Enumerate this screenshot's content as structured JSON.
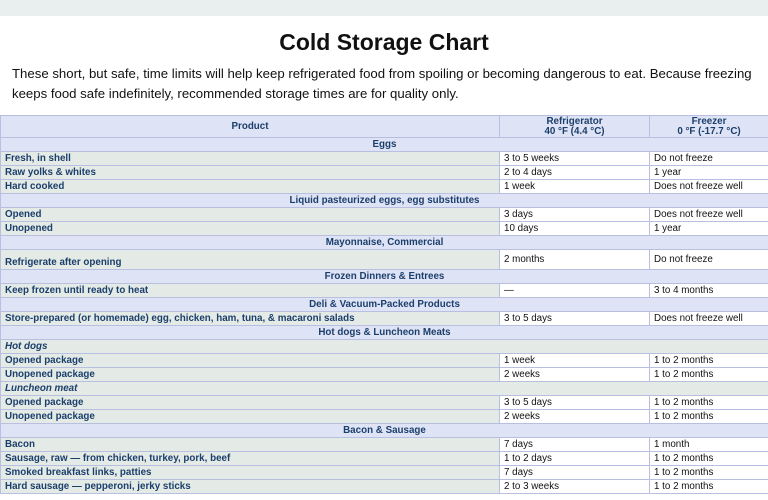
{
  "page": {
    "title": "Cold Storage Chart",
    "intro": "These short, but safe, time limits will help keep refrigerated food from spoiling or becoming dangerous to eat. Because freezing keeps food safe indefinitely, recommended storage times are for quality only."
  },
  "table": {
    "headers": {
      "product": "Product",
      "refrigerator": "Refrigerator",
      "refrigerator_temp": "40 °F (4.4 °C)",
      "freezer": "Freezer",
      "freezer_temp": "0 °F (-17.7 °C)"
    },
    "rows": [
      {
        "type": "cat",
        "label": "Eggs"
      },
      {
        "type": "item",
        "product": "Fresh, in shell",
        "refrigerator": "3 to 5 weeks",
        "freezer": "Do not freeze"
      },
      {
        "type": "item",
        "product": "Raw yolks & whites",
        "refrigerator": "2 to 4 days",
        "freezer": "1 year"
      },
      {
        "type": "item",
        "product": "Hard cooked",
        "refrigerator": "1 week",
        "freezer": "Does not freeze well"
      },
      {
        "type": "cat",
        "label": "Liquid pasteurized eggs, egg substitutes"
      },
      {
        "type": "item",
        "product": "Opened",
        "refrigerator": "3 days",
        "freezer": "Does not freeze well"
      },
      {
        "type": "item",
        "product": "Unopened",
        "refrigerator": "10 days",
        "freezer": "1 year"
      },
      {
        "type": "cat",
        "label": "Mayonnaise, Commercial"
      },
      {
        "type": "item",
        "tall": true,
        "product": "Refrigerate after opening",
        "refrigerator": "2 months",
        "freezer": "Do not freeze"
      },
      {
        "type": "cat",
        "label": "Frozen Dinners & Entrees"
      },
      {
        "type": "item",
        "product": "Keep frozen until ready to heat",
        "refrigerator": "—",
        "freezer": "3 to 4 months"
      },
      {
        "type": "cat",
        "label": "Deli & Vacuum-Packed Products"
      },
      {
        "type": "item",
        "product": "Store-prepared (or homemade) egg, chicken, ham, tuna, & macaroni salads",
        "refrigerator": "3 to 5 days",
        "freezer": "Does not freeze well"
      },
      {
        "type": "cat",
        "label": "Hot dogs & Luncheon Meats"
      },
      {
        "type": "sub",
        "label": "Hot dogs"
      },
      {
        "type": "item",
        "product": "Opened package",
        "refrigerator": "1 week",
        "freezer": "1 to 2 months"
      },
      {
        "type": "item",
        "product": "Unopened package",
        "refrigerator": "2 weeks",
        "freezer": "1 to 2 months"
      },
      {
        "type": "sub",
        "label": "Luncheon meat"
      },
      {
        "type": "item",
        "product": "Opened package",
        "refrigerator": "3 to 5 days",
        "freezer": "1 to 2 months"
      },
      {
        "type": "item",
        "product": "Unopened package",
        "refrigerator": "2 weeks",
        "freezer": "1 to 2 months"
      },
      {
        "type": "cat",
        "label": "Bacon & Sausage"
      },
      {
        "type": "item",
        "product": "Bacon",
        "refrigerator": "7 days",
        "freezer": "1 month"
      },
      {
        "type": "item",
        "product": "Sausage, raw — from chicken, turkey, pork, beef",
        "refrigerator": "1 to 2 days",
        "freezer": "1 to 2 months"
      },
      {
        "type": "item",
        "product": "Smoked breakfast links, patties",
        "refrigerator": "7 days",
        "freezer": "1 to 2 months"
      },
      {
        "type": "item",
        "product": "Hard sausage — pepperoni, jerky sticks",
        "refrigerator": "2 to 3 weeks",
        "freezer": "1 to 2 months"
      }
    ]
  }
}
